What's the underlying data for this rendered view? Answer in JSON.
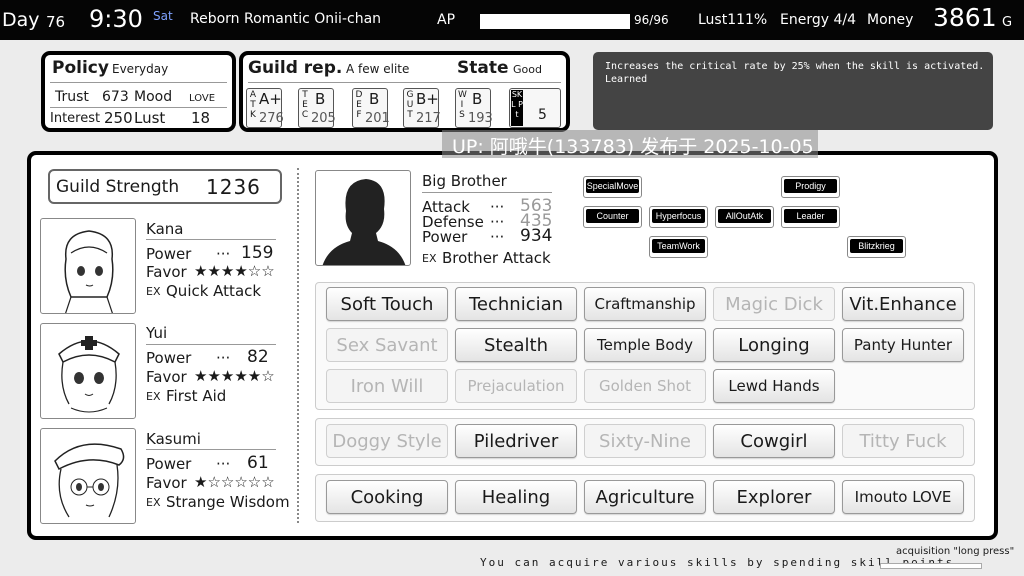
{
  "topbar": {
    "day_label": "Day",
    "day": "76",
    "time": "9:30",
    "weekday": "Sat",
    "title": "Reborn Romantic Onii-chan",
    "ap_label": "AP",
    "ap_value": "96/96",
    "ap_fraction": 1.0,
    "lust": "Lust111%",
    "energy": "Energy 4/4",
    "money_label": "Money",
    "money": "3861",
    "currency": "G"
  },
  "policy": {
    "title": "Policy",
    "value": "Everyday",
    "trust_label": "Trust",
    "trust": "673",
    "mood_label": "Mood",
    "mood": "LOVE",
    "interest_label": "Interest",
    "interest": "250",
    "lust_label": "Lust",
    "lust": "18"
  },
  "guild": {
    "rep_label": "Guild rep.",
    "rep_value": "A  few  elite",
    "state_label": "State",
    "state_value": "Good",
    "stats": [
      {
        "name": "ATK",
        "grade": "A+",
        "value": "276"
      },
      {
        "name": "TEC",
        "grade": "B",
        "value": "205"
      },
      {
        "name": "DEF",
        "grade": "B",
        "value": "201"
      },
      {
        "name": "GUT",
        "grade": "B+",
        "value": "217"
      },
      {
        "name": "WIS",
        "grade": "B",
        "value": "193"
      }
    ],
    "skl_label": "SKL Pt",
    "skl_value": "5"
  },
  "description": {
    "line1": "Increases the critical rate by 25% when the skill is activated.",
    "line2": "Learned"
  },
  "overlay": {
    "text": "UP: 阿哦牛(133783) 发布于 2025-10-05"
  },
  "strength": {
    "label": "Guild Strength",
    "value": "1236"
  },
  "members": [
    {
      "name": "Kana",
      "power": "159",
      "favor": "★★★★☆☆",
      "ex": "Quick Attack"
    },
    {
      "name": "Yui",
      "power": "82",
      "favor": "★★★★★☆",
      "ex": "First Aid"
    },
    {
      "name": "Kasumi",
      "power": "61",
      "favor": "★☆☆☆☆☆",
      "ex": "Strange Wisdom"
    }
  ],
  "labels": {
    "power": "Power",
    "favor": "Favor",
    "dots": "···",
    "ex": "EX"
  },
  "brother": {
    "name": "Big Brother",
    "attack_label": "Attack",
    "attack": "563",
    "defense_label": "Defense",
    "defense": "435",
    "power_label": "Power",
    "power": "934",
    "ex": "Brother Attack"
  },
  "tags": [
    "SpecialMove",
    "Prodigy",
    "Counter",
    "Hyperfocus",
    "AllOutAtk",
    "Leader",
    "TeamWork",
    "Blitzkrieg"
  ],
  "skills": {
    "group1": [
      {
        "label": "Soft Touch",
        "active": true
      },
      {
        "label": "Technician",
        "active": true
      },
      {
        "label": "Craftmanship",
        "active": true
      },
      {
        "label": "Magic Dick",
        "active": false
      },
      {
        "label": "Vit.Enhance",
        "active": true
      },
      {
        "label": "Sex Savant",
        "active": false
      },
      {
        "label": "Stealth",
        "active": true
      },
      {
        "label": "Temple Body",
        "active": true
      },
      {
        "label": "Longing",
        "active": true
      },
      {
        "label": "Panty Hunter",
        "active": true
      },
      {
        "label": "Iron Will",
        "active": false
      },
      {
        "label": "Prejaculation",
        "active": false
      },
      {
        "label": "Golden Shot",
        "active": false
      },
      {
        "label": "Lewd Hands",
        "active": true
      }
    ],
    "group2": [
      {
        "label": "Doggy Style",
        "active": false
      },
      {
        "label": "Piledriver",
        "active": true
      },
      {
        "label": "Sixty-Nine",
        "active": false
      },
      {
        "label": "Cowgirl",
        "active": true
      },
      {
        "label": "Titty Fuck",
        "active": false
      }
    ],
    "group3": [
      {
        "label": "Cooking",
        "active": true
      },
      {
        "label": "Healing",
        "active": true
      },
      {
        "label": "Agriculture",
        "active": true
      },
      {
        "label": "Explorer",
        "active": true
      },
      {
        "label": "Imouto LOVE",
        "active": true
      }
    ]
  },
  "footer": {
    "hint": "You can acquire various skills by spending skill points.",
    "acquisition": "acquisition \"long press\""
  }
}
